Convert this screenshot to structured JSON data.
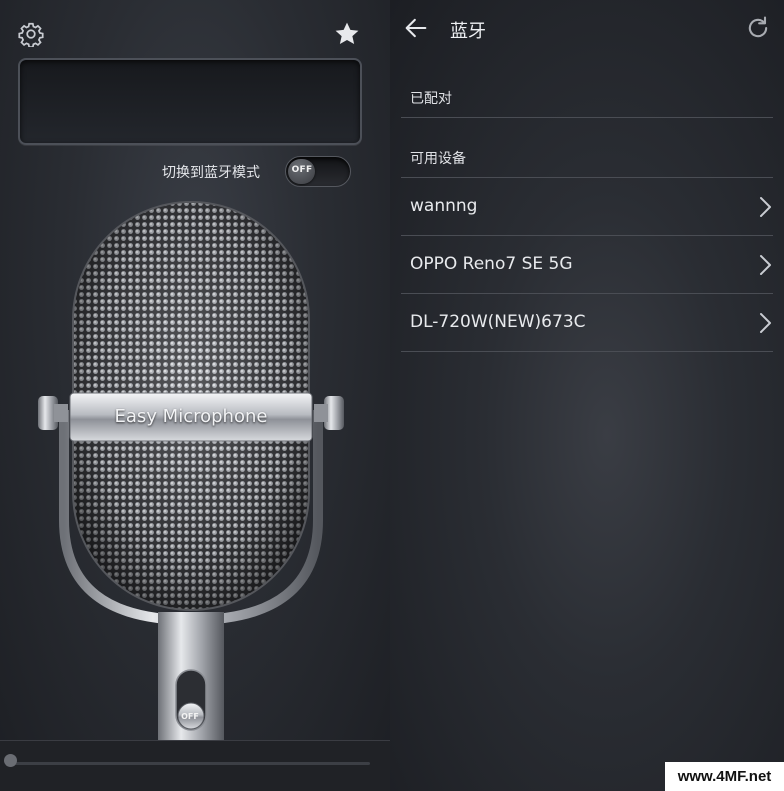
{
  "left_panel": {
    "mode_toggle": {
      "label": "切换到蓝牙模式",
      "state": "OFF"
    },
    "microphone": {
      "brand": "Easy Microphone",
      "switch_state": "OFF"
    },
    "volume_slider": {
      "value": 0
    }
  },
  "bluetooth_panel": {
    "title": "蓝牙",
    "paired_header": "已配对",
    "available_header": "可用设备",
    "devices": [
      {
        "name": "wannng"
      },
      {
        "name": "OPPO Reno7 SE 5G"
      },
      {
        "name": "DL-720W(NEW)673C"
      }
    ]
  },
  "watermark": {
    "text": "www.4MF.net"
  },
  "icons": {
    "settings": "gear-icon",
    "favorite": "star-icon",
    "back": "back-arrow-icon",
    "refresh": "refresh-icon",
    "chevron": "chevron-right-icon"
  },
  "colors": {
    "background": "#2a2d33",
    "text": "#e6e8ec",
    "divider": "#4a4d54"
  }
}
